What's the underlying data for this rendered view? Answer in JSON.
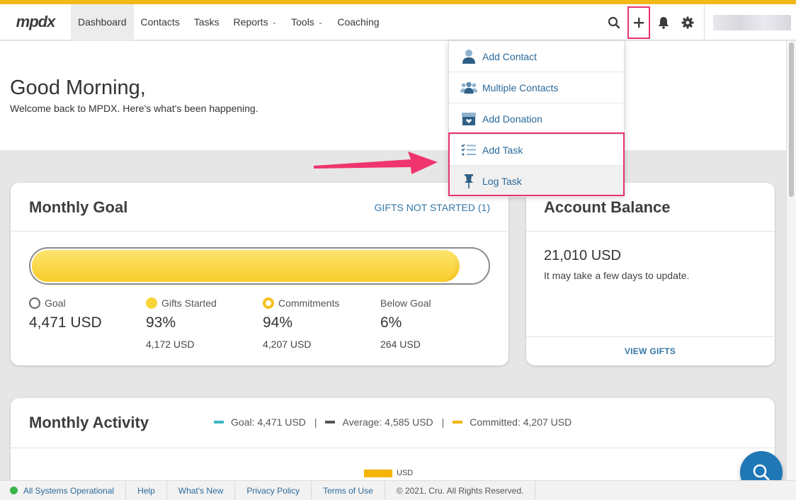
{
  "brand": {
    "logo_text": "mpdx"
  },
  "nav": {
    "items": [
      {
        "label": "Dashboard",
        "active": true,
        "has_caret": false
      },
      {
        "label": "Contacts",
        "active": false,
        "has_caret": false
      },
      {
        "label": "Tasks",
        "active": false,
        "has_caret": false
      },
      {
        "label": "Reports",
        "active": false,
        "has_caret": true
      },
      {
        "label": "Tools",
        "active": false,
        "has_caret": true
      },
      {
        "label": "Coaching",
        "active": false,
        "has_caret": false
      }
    ],
    "right_icons": [
      "search-icon",
      "plus-icon",
      "bell-icon",
      "gear-icon"
    ]
  },
  "greeting": {
    "title": "Good Morning,",
    "subtitle": "Welcome back to MPDX. Here's what's been happening."
  },
  "add_menu": {
    "items": [
      {
        "label": "Add Contact",
        "icon": "person-icon"
      },
      {
        "label": "Multiple Contacts",
        "icon": "people-icon"
      },
      {
        "label": "Add Donation",
        "icon": "gift-box-icon"
      },
      {
        "label": "Add Task",
        "icon": "checklist-icon"
      },
      {
        "label": "Log Task",
        "icon": "pushpin-icon"
      }
    ]
  },
  "monthly_goal": {
    "title": "Monthly Goal",
    "link": "GIFTS NOT STARTED (1)",
    "progress": {
      "commitments_fraction": 0.94,
      "gifts_started_fraction": 0.93
    },
    "stats": {
      "goal": {
        "label": "Goal",
        "value": "4,471 USD"
      },
      "gifts_started": {
        "label": "Gifts Started",
        "value": "93%",
        "sub": "4,172 USD"
      },
      "commitments": {
        "label": "Commitments",
        "value": "94%",
        "sub": "4,207 USD"
      },
      "below_goal": {
        "label": "Below Goal",
        "value": "6%",
        "sub": "264 USD"
      }
    }
  },
  "account_balance": {
    "title": "Account Balance",
    "value": "21,010 USD",
    "note": "It may take a few days to update.",
    "footer_link": "VIEW GIFTS"
  },
  "monthly_activity": {
    "title": "Monthly Activity",
    "legend": {
      "goal": "Goal: 4,471 USD",
      "average": "Average: 4,585 USD",
      "committed": "Committed: 4,207 USD",
      "separator": "|"
    },
    "series_key": "USD"
  },
  "footer": {
    "status": "All Systems Operational",
    "links": [
      "Help",
      "What's New",
      "Privacy Policy",
      "Terms of Use"
    ],
    "copyright": "© 2021, Cru. All Rights Reserved."
  },
  "colors": {
    "accent_yellow": "#f2b81a",
    "link_blue": "#3577a6",
    "highlight_pink": "#e6336e",
    "goal_teal": "#3fb6c3",
    "average_gray": "#555555",
    "committed_yellow": "#f5b400",
    "status_green": "#3cb44b"
  }
}
